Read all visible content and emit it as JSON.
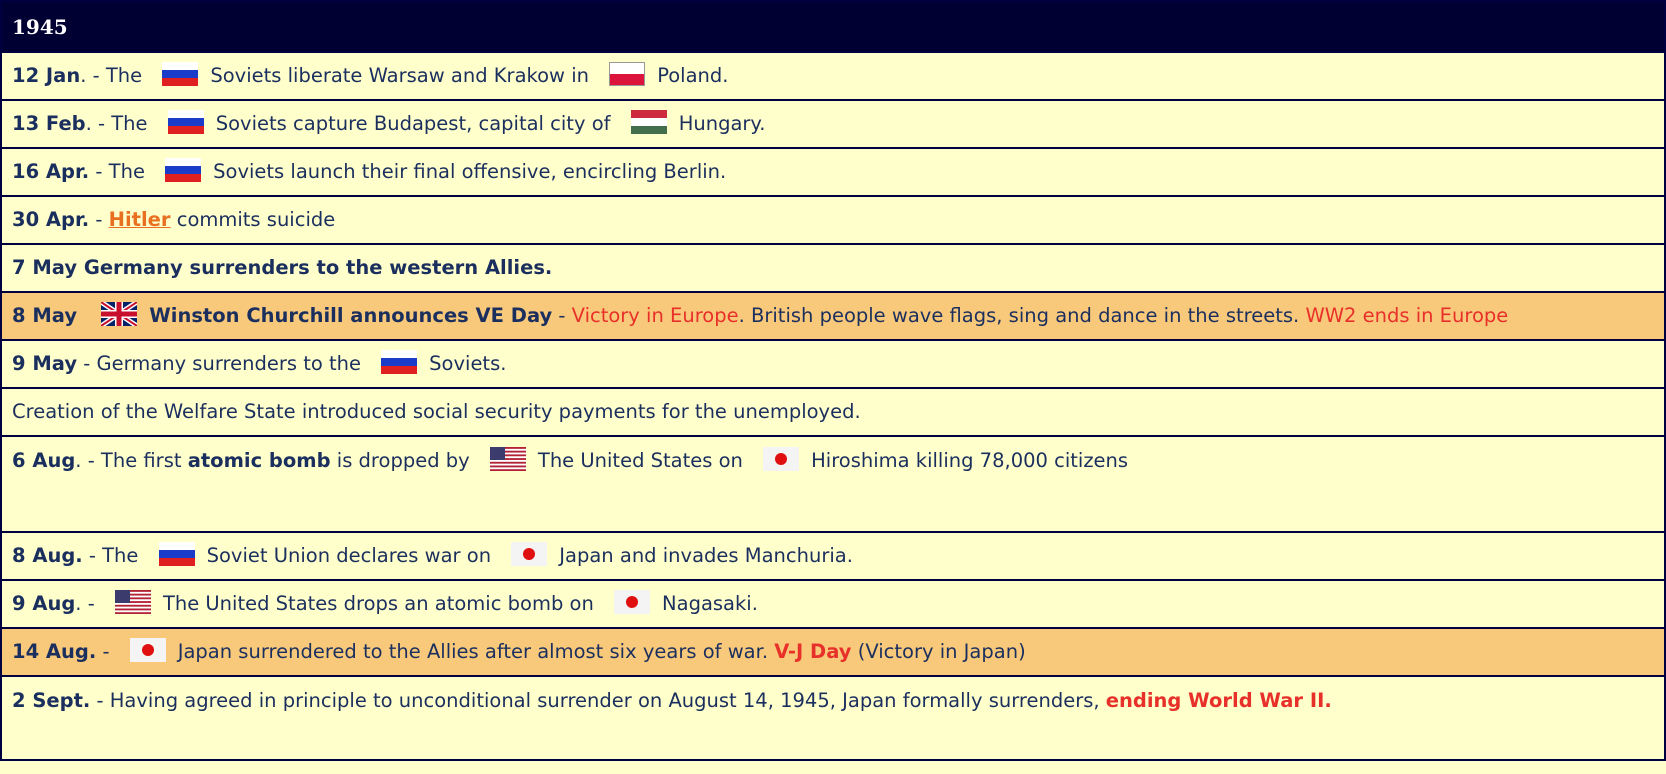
{
  "year": "1945",
  "rows": [
    {
      "date": "12 Jan",
      "a": ". - The",
      "b": "Soviets liberate Warsaw and Krakow in",
      "c": "Poland."
    },
    {
      "date": "13 Feb",
      "a": ". - The",
      "b": "Soviets capture Budapest, capital city of",
      "c": "Hungary."
    },
    {
      "date": "16 Apr.",
      "a": " - The",
      "b": "Soviets launch their final offensive, encircling Berlin."
    },
    {
      "date": "30 Apr.",
      "a": " - ",
      "link": "Hitler",
      "b": " commits suicide"
    },
    {
      "text": "7 May Germany surrenders to the western Allies."
    },
    {
      "date": "8 May",
      "b": "Winston Churchill announces VE Day",
      "dash": " - ",
      "red1": "Victory in Europe",
      "mid": ". British people wave flags, sing and dance in the streets. ",
      "red2": "WW2 ends in Europe"
    },
    {
      "date": "9 May",
      "a": " - Germany surrenders to the",
      "c": "Soviets."
    },
    {
      "text": "Creation of the Welfare State introduced social security payments for the unemployed."
    },
    {
      "date": "6 Aug",
      "a": ". - The first ",
      "bold": "atomic bomb",
      "a2": " is dropped by",
      "b": "The United States on",
      "c": "Hiroshima killing 78,000 citizens"
    },
    {
      "date": "8 Aug.",
      "a": " - The",
      "b": "Soviet Union declares war on",
      "c": "Japan and invades Manchuria."
    },
    {
      "date": "9 Aug",
      "a": ". -",
      "b": "The United States drops an atomic bomb on",
      "c": "Nagasaki."
    },
    {
      "date": "14 Aug.",
      "a": " -",
      "b": "Japan surrendered to the Allies after almost six years of war. ",
      "red": "V-J Day",
      "c": " (Victory in Japan)"
    },
    {
      "date": "2 Sept.",
      "a": " - Having agreed in principle to unconditional surrender on August 14, 1945, Japan formally surrenders, ",
      "red": "ending World War II."
    }
  ],
  "flags": {
    "soviet": [
      "#ffffff",
      "#1a3cc8",
      "#e02020"
    ],
    "poland": [
      "#ffffff",
      "#dc143c"
    ],
    "hungary": [
      "#cd2a3e",
      "#ffffff",
      "#436f4d"
    ],
    "usa_stripe": "#b22234",
    "usa_canton": "#3c3b6e",
    "japan_disc": "#e01010",
    "uk_blue": "#012169",
    "uk_red": "#c8102e"
  },
  "colors": {
    "header_bg": "#000033",
    "row_bg": "#ffffcc",
    "highlight_bg": "#f8c97a",
    "text": "#1b2f5e",
    "red_text": "#e8302a",
    "link": "#e87020"
  }
}
